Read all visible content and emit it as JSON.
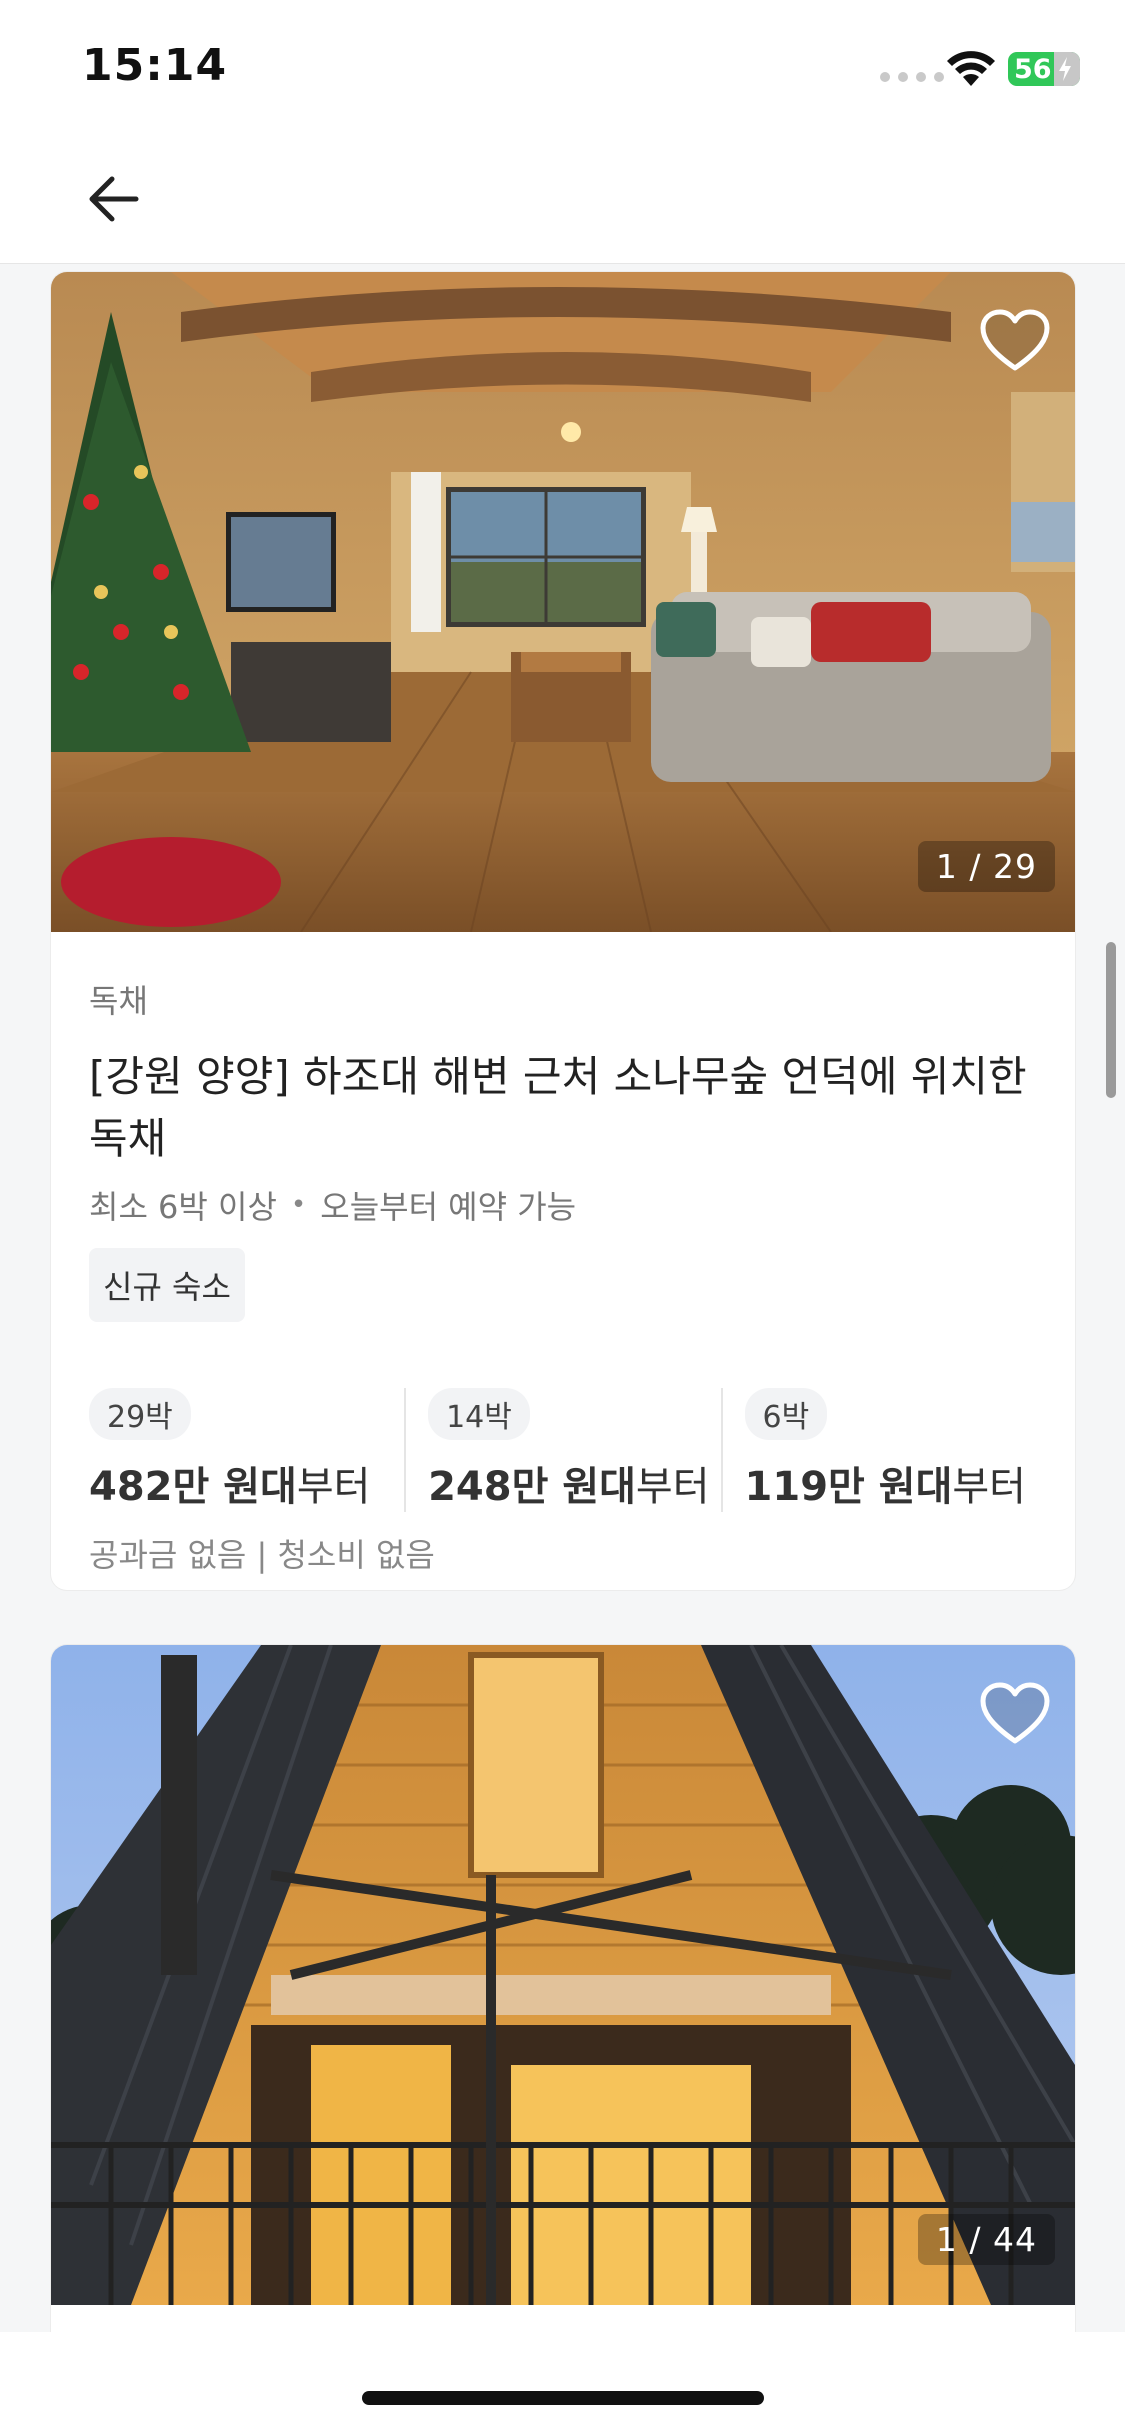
{
  "status_bar": {
    "time": "15:14",
    "battery": "56"
  },
  "listings": [
    {
      "photo_counter": "1 / 29",
      "category": "독채",
      "title": "[강원 양양] 하조대 해변 근처 소나무숲 언덕에 위치한 독채",
      "min_stay": "최소 6박 이상",
      "availability": "오늘부터 예약 가능",
      "badge": "신규 숙소",
      "prices": [
        {
          "nights": "29박",
          "amount": "482만 원대",
          "suffix": "부터"
        },
        {
          "nights": "14박",
          "amount": "248만 원대",
          "suffix": "부터"
        },
        {
          "nights": "6박",
          "amount": "119만 원대",
          "suffix": "부터"
        }
      ],
      "fees": "공과금 없음 | 청소비 없음"
    },
    {
      "photo_counter": "1 / 44"
    }
  ],
  "icons": {
    "back": "arrow-left-icon",
    "favorite": "heart-outline-icon",
    "wifi": "wifi-icon",
    "battery": "battery-charging-icon"
  },
  "colors": {
    "battery_green": "#30c758",
    "background": "#f5f6f7"
  }
}
